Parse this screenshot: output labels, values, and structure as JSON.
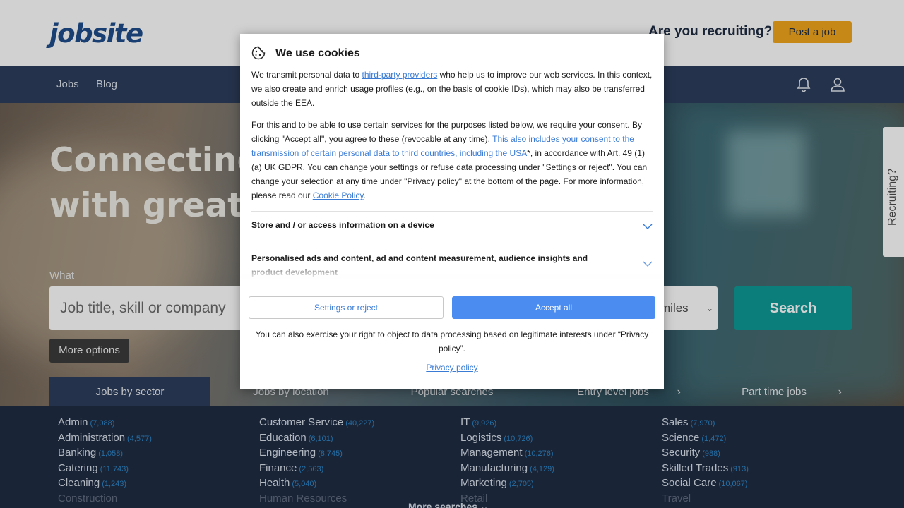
{
  "header": {
    "logo": "jobsite",
    "recruiting_prompt": "Are you recruiting?",
    "post_job": "Post a job"
  },
  "nav": {
    "links": [
      "Jobs",
      "Blog"
    ],
    "icons": [
      "bell-icon",
      "user-icon"
    ]
  },
  "hero": {
    "title_line1": "Connecting",
    "title_line2": "with great jo",
    "what_label": "What",
    "what_placeholder": "Job title, skill or company",
    "radius_value": "miles",
    "search_button": "Search",
    "more_options": "More options"
  },
  "tabs": [
    {
      "label": "Jobs by sector"
    },
    {
      "label": "Jobs by location"
    },
    {
      "label": "Popular searches"
    },
    {
      "label": "Entry level jobs"
    },
    {
      "label": "Part time jobs"
    }
  ],
  "side_tab": "Recruiting?",
  "sectors": {
    "col1": [
      {
        "name": "Admin",
        "count": "(7,088)"
      },
      {
        "name": "Administration",
        "count": "(4,577)"
      },
      {
        "name": "Banking",
        "count": "(1,058)"
      },
      {
        "name": "Catering",
        "count": "(11,743)"
      },
      {
        "name": "Cleaning",
        "count": "(1,243)"
      },
      {
        "name": "Construction",
        "count": ""
      }
    ],
    "col2": [
      {
        "name": "Customer Service",
        "count": "(40,227)"
      },
      {
        "name": "Education",
        "count": "(6,101)"
      },
      {
        "name": "Engineering",
        "count": "(8,745)"
      },
      {
        "name": "Finance",
        "count": "(2,563)"
      },
      {
        "name": "Health",
        "count": "(5,040)"
      },
      {
        "name": "Human Resources",
        "count": ""
      }
    ],
    "col3": [
      {
        "name": "IT",
        "count": "(9,926)"
      },
      {
        "name": "Logistics",
        "count": "(10,726)"
      },
      {
        "name": "Management",
        "count": "(10,276)"
      },
      {
        "name": "Manufacturing",
        "count": "(4,129)"
      },
      {
        "name": "Marketing",
        "count": "(2,705)"
      },
      {
        "name": "Retail",
        "count": ""
      }
    ],
    "col4": [
      {
        "name": "Sales",
        "count": "(7,970)"
      },
      {
        "name": "Science",
        "count": "(1,472)"
      },
      {
        "name": "Security",
        "count": "(988)"
      },
      {
        "name": "Skilled Trades",
        "count": "(913)"
      },
      {
        "name": "Social Care",
        "count": "(10,067)"
      },
      {
        "name": "Travel",
        "count": ""
      }
    ],
    "more_searches": "More searches"
  },
  "cookie": {
    "title": "We use cookies",
    "p1_a": "We transmit personal data to ",
    "p1_link": "third-party providers",
    "p1_b": " who help us to improve our web services. In this context, we also create and enrich usage profiles (e.g., on the basis of cookie IDs), which may also be transferred outside the EEA.",
    "p2_a": "For this and to be able to use certain services for the purposes listed below, we require your consent. By clicking \"Accept all\", you agree to these (revocable at any time). ",
    "p2_link": "This also includes your consent to the transmission of certain personal data to third countries, including the USA",
    "p2_b": "*, in accordance with Art. 49 (1) (a) UK GDPR. You can change your settings or refuse data processing under \"Settings or reject\". You can change your selection at any time under \"Privacy policy\" at the bottom of the page. For more information, please read our ",
    "p2_link2": "Cookie Policy",
    "p2_c": ".",
    "section1": "Store and / or access information on a device",
    "section2": "Personalised ads and content, ad and content measurement, audience insights and product development",
    "settings_button": "Settings or reject",
    "accept_button": "Accept all",
    "object_text": "You can also exercise your right to object to data processing based on legitimate interests under “Privacy policy”.",
    "privacy_link": "Privacy policy"
  }
}
